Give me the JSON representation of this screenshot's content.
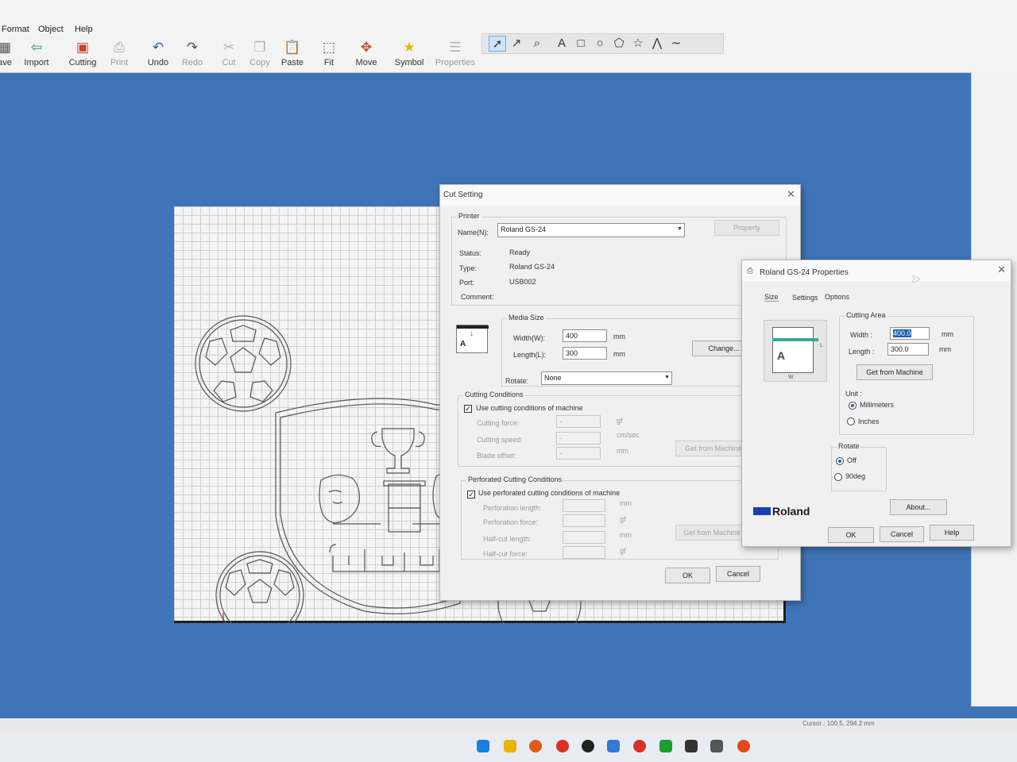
{
  "menu": [
    "Format",
    "Object",
    "Help"
  ],
  "toolbar": [
    {
      "label": "ave",
      "icon": "save-icon",
      "enabled": true
    },
    {
      "label": "Import",
      "icon": "import-icon",
      "enabled": true
    },
    {
      "label": "Cutting",
      "icon": "cutting-icon",
      "enabled": true
    },
    {
      "label": "Print",
      "icon": "printer-icon",
      "enabled": false
    },
    {
      "label": "Undo",
      "icon": "undo-icon",
      "enabled": true
    },
    {
      "label": "Redo",
      "icon": "redo-icon",
      "enabled": false
    },
    {
      "label": "Cut",
      "icon": "cut-icon",
      "enabled": false
    },
    {
      "label": "Copy",
      "icon": "copy-icon",
      "enabled": false
    },
    {
      "label": "Paste",
      "icon": "paste-icon",
      "enabled": true
    },
    {
      "label": "Fit",
      "icon": "fit-icon",
      "enabled": true
    },
    {
      "label": "Move",
      "icon": "move-icon",
      "enabled": true
    },
    {
      "label": "Symbol",
      "icon": "star-icon",
      "enabled": true
    },
    {
      "label": "Properties",
      "icon": "properties-icon",
      "enabled": false
    }
  ],
  "draw_tools": [
    "pointer-icon",
    "node-edit-icon",
    "zoom-icon",
    "text-icon",
    "rectangle-icon",
    "circle-icon",
    "pentagon-icon",
    "star-icon",
    "polyline-icon",
    "curve-icon"
  ],
  "draw_tool_glyphs": [
    "➚",
    "↗",
    "⌕",
    "A",
    "□",
    "○",
    "⬠",
    "☆",
    "⋀",
    "∼"
  ],
  "cut_setting": {
    "title": "Cut Setting",
    "printer": {
      "legend": "Printer",
      "name_label": "Name(N):",
      "name_value": "Roland GS-24",
      "property_btn": "Property",
      "status_label": "Status:",
      "status_value": "Ready",
      "type_label": "Type:",
      "type_value": "Roland GS-24",
      "port_label": "Port:",
      "port_value": "USB002",
      "comment_label": "Comment:"
    },
    "media": {
      "legend": "Media Size",
      "width_label": "Width(W):",
      "width_value": "400",
      "width_unit": "mm",
      "length_label": "Length(L):",
      "length_value": "300",
      "length_unit": "mm",
      "change_btn": "Change...",
      "rotate_label": "Rotate:",
      "rotate_value": "None"
    },
    "cutting_conditions": {
      "legend": "Cutting Conditions",
      "use_machine": "Use cutting conditions of machine",
      "force_label": "Cutting force:",
      "force_unit": "gf",
      "speed_label": "Cutting speed:",
      "speed_unit": "cm/sec",
      "offset_label": "Blade offset:",
      "offset_unit": "mm",
      "field_placeholder": "-",
      "get_btn": "Get from Machine"
    },
    "perforated": {
      "legend": "Perforated Cutting Conditions",
      "use_machine": "Use perforated cutting conditions of machine",
      "perf_length": "Perforation length:",
      "perf_length_unit": "mm",
      "perf_force": "Perforation force:",
      "perf_force_unit": "gf",
      "half_length": "Half-cut length:",
      "half_length_unit": "mm",
      "half_force": "Half-cut force:",
      "half_force_unit": "gf",
      "get_btn": "Get from Machine"
    },
    "ok": "OK",
    "cancel": "Cancel"
  },
  "props": {
    "title": "Roland GS-24 Properties",
    "tabs": [
      "Size",
      "Settings",
      "Options"
    ],
    "cutting_area": "Cutting Area",
    "width_label": "Width :",
    "width_value": "400.0",
    "width_unit": "mm",
    "length_label": "Length :",
    "length_value": "300.0",
    "length_unit": "mm",
    "get_btn": "Get from Machine",
    "unit_label": "Unit :",
    "unit_mm": "Millimeters",
    "unit_in": "Inches",
    "rotate_label": "Rotate",
    "rotate_off": "Off",
    "rotate_90": "90deg",
    "brand": "Roland",
    "about": "About...",
    "ok": "OK",
    "cancel": "Cancel",
    "help": "Help",
    "diagram_L": "L",
    "diagram_W": "W",
    "diagram_A": "A"
  },
  "status": {
    "cursor": "Cursor : 100.5, 294.2 mm"
  },
  "colors": {
    "desktop": "#3f74b8",
    "accent": "#1a5fb4",
    "brand": "#1a3fb5"
  }
}
